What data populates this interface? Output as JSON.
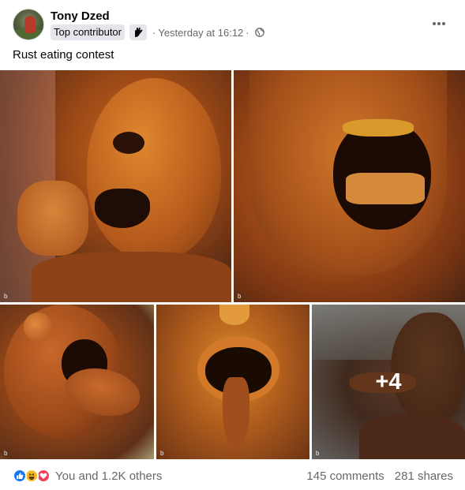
{
  "post": {
    "author": "Tony Dzed",
    "badge": "Top contributor",
    "timestamp": "Yesterday at 16:12",
    "separator": "·",
    "audience_icon": "globe-icon",
    "more_icon": "more-horizontal-icon",
    "caption": "Rust eating contest"
  },
  "photos": {
    "more_overlay": "+4",
    "corner_mark": "b"
  },
  "footer": {
    "reaction_icons": [
      "like-icon",
      "haha-icon",
      "love-icon"
    ],
    "reaction_summary": "You and 1.2K others",
    "comments": "145 comments",
    "shares": "281 shares"
  },
  "colors": {
    "secondary_text": "#65676b",
    "badge_bg": "#e4e6eb",
    "like_blue": "#1877f2",
    "haha_yellow": "#f7b928",
    "love_red": "#f33e58"
  }
}
